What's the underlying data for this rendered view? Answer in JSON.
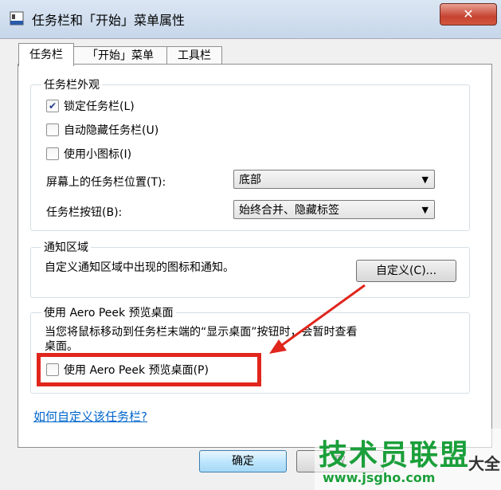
{
  "window": {
    "title": "任务栏和「开始」菜单属性",
    "close_symbol": "✕"
  },
  "tabs": [
    {
      "label": "任务栏"
    },
    {
      "label": "「开始」菜单"
    },
    {
      "label": "工具栏"
    }
  ],
  "appearance": {
    "legend": "任务栏外观",
    "lock": {
      "label": "锁定任务栏(L)",
      "checked": true
    },
    "autohide": {
      "label": "自动隐藏任务栏(U)",
      "checked": false
    },
    "small_icons": {
      "label": "使用小图标(I)",
      "checked": false
    },
    "position": {
      "label": "屏幕上的任务栏位置(T):",
      "value": "底部"
    },
    "buttons": {
      "label": "任务栏按钮(B):",
      "value": "始终合并、隐藏标签"
    }
  },
  "notification": {
    "legend": "通知区域",
    "description": "自定义通知区域中出现的图标和通知。",
    "customize_label": "自定义(C)..."
  },
  "aero_peek": {
    "legend": "使用 Aero Peek 预览桌面",
    "description_line1": "当您将鼠标移动到任务栏末端的“显示桌面”按钮时，会暂时查看",
    "description_line2": "桌面。",
    "checkbox": {
      "label": "使用 Aero Peek 预览桌面(P)",
      "checked": false
    }
  },
  "help_link": "如何自定义该任务栏?",
  "footer": {
    "ok_label": "确定",
    "cancel_label": "取"
  },
  "watermark": {
    "brand": "技术员联盟",
    "url": "www.jsgho.com",
    "suffix": "大全"
  },
  "colors": {
    "highlight": "#e0261d",
    "link": "#0066cc",
    "watermark": "#1a9f3a"
  }
}
